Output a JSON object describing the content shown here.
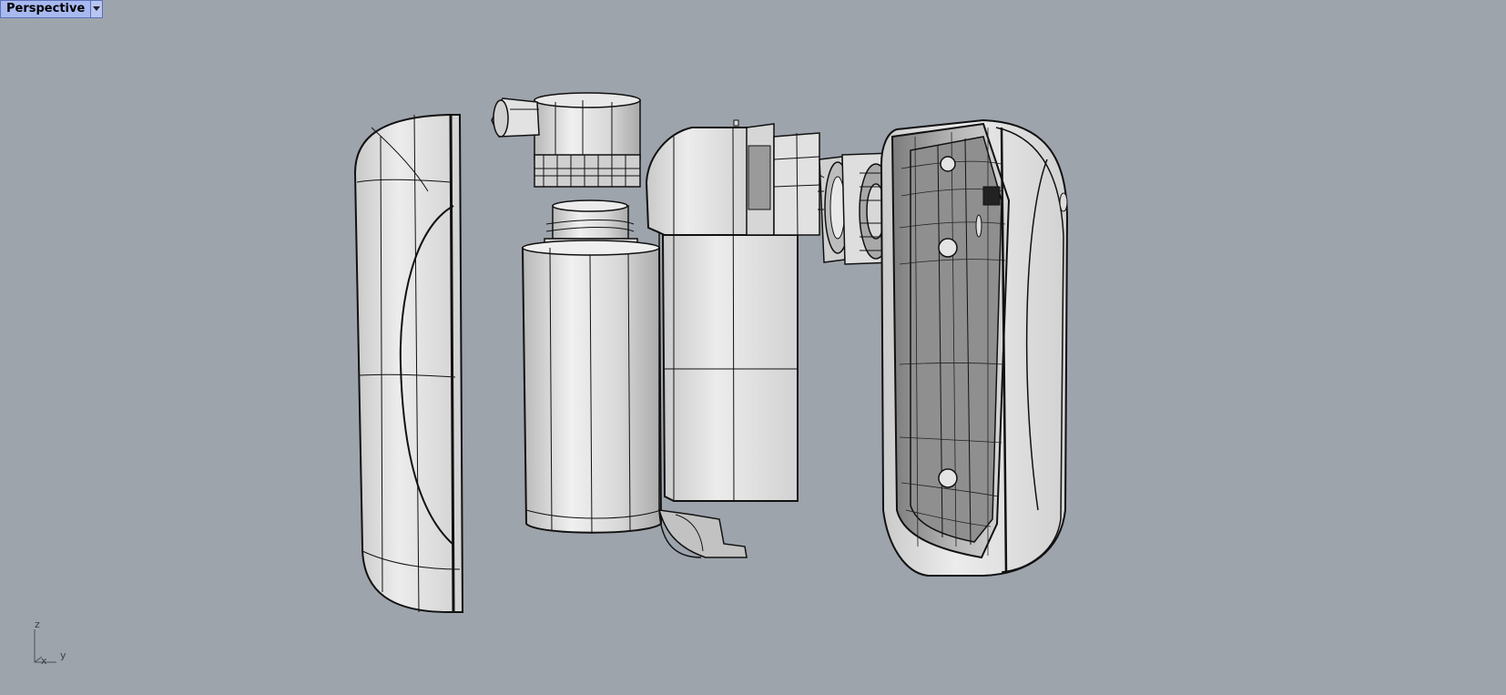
{
  "viewport": {
    "name": "Perspective",
    "background_color": "#9ea4ac",
    "tab_color": "#a8b9f0",
    "dropdown_icon": "triangle-down-icon"
  },
  "axes": {
    "z_label": "z",
    "x_label": "x",
    "y_label": "y"
  },
  "model": {
    "render_mode": "shaded-wireframe",
    "surface_color": "#dcdcdc",
    "edge_color": "#111111"
  }
}
